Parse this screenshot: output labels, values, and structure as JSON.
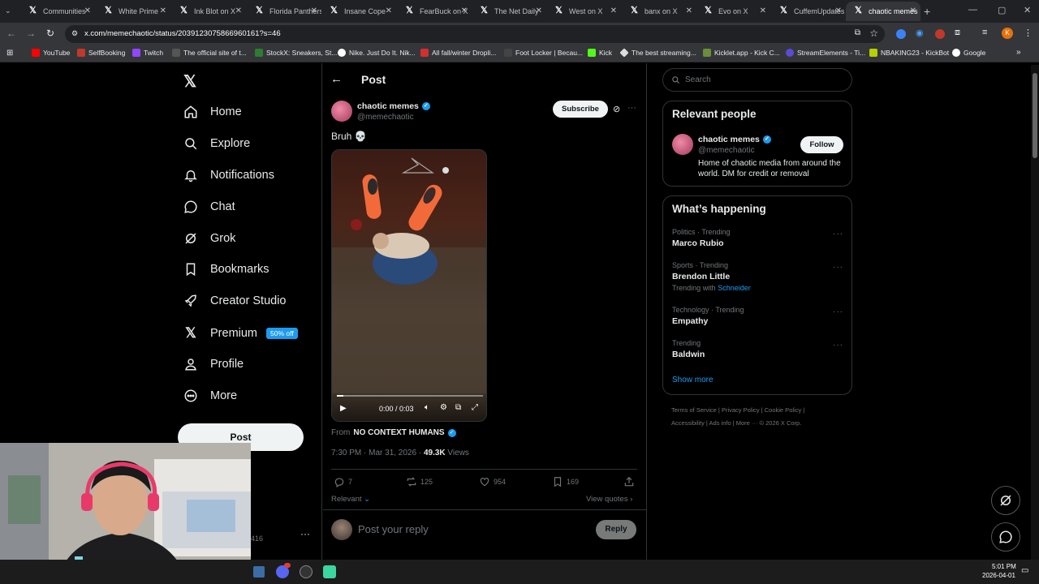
{
  "browser": {
    "tabs": [
      "Communities",
      "White Prime",
      "Ink Blot on X",
      "Florida Panthers",
      "Insane Cope",
      "FearBuck on X",
      "The Net Daily",
      "West on X",
      "banx on X",
      "Evo on X",
      "CuffemUpdates",
      "chaotic memes"
    ],
    "url": "x.com/memechaotic/status/2039123075866960161?s=46",
    "bookmarks": [
      "YouTube",
      "SelfBooking",
      "Twitch",
      "The official site of t...",
      "StockX: Sneakers, St...",
      "Nike. Just Do It. Nik...",
      "All fall/winter Dropli...",
      "Foot Locker | Becau...",
      "Kick",
      "The best streaming...",
      "Kicklet.app - Kick C...",
      "StreamElements - Ti...",
      "NBAKING23 - KickBot",
      "Google"
    ]
  },
  "nav": {
    "items": [
      "Home",
      "Explore",
      "Notifications",
      "Chat",
      "Grok",
      "Bookmarks",
      "Creator Studio",
      "Premium",
      "Profile",
      "More"
    ],
    "premium_badge": "50% off",
    "post_button": "Post"
  },
  "post": {
    "header": "Post",
    "author_name": "chaotic memes",
    "author_handle": "@memechaotic",
    "subscribe": "Subscribe",
    "text": "Bruh 💀",
    "video_time": "0:00 / 0:03",
    "from_label": "From",
    "from_account": "NO CONTEXT HUMANS",
    "timestamp": "7:30 PM · Mar 31, 2026 · ",
    "views_count": "49.3K",
    "views_label": "Views",
    "replies": "7",
    "reposts": "125",
    "likes": "954",
    "bookmarks": "169",
    "sort": "Relevant",
    "view_quotes": "View quotes",
    "reply_placeholder": "Post your reply",
    "reply_button": "Reply"
  },
  "sidebar": {
    "search_placeholder": "Search",
    "relevant_title": "Relevant people",
    "person_name": "chaotic memes",
    "person_handle": "@memechaotic",
    "follow": "Follow",
    "bio": "Home of chaotic media from around the world. DM for credit or removal",
    "happening_title": "What’s happening",
    "trends": [
      {
        "category": "Politics · Trending",
        "name": "Marco Rubio",
        "extra": ""
      },
      {
        "category": "Sports · Trending",
        "name": "Brendon Little",
        "extra": "Trending with"
      },
      {
        "category": "Technology · Trending",
        "name": "Empathy",
        "extra": ""
      },
      {
        "category": "Trending",
        "name": "Baldwin",
        "extra": ""
      }
    ],
    "trend_link": "Schneider",
    "show_more": "Show more",
    "footer1": "Terms of Service  |  Privacy Policy  |  Cookie Policy  |",
    "footer2": "Accessibility  |  Ads info  |  More ···  © 2026 X Corp."
  },
  "taskbar": {
    "time": "5:01 PM",
    "date": "2026-04-01",
    "partial_count": "416"
  },
  "colors": {
    "accent": "#1d9bf0",
    "background": "#000000",
    "border": "#2f3336"
  }
}
